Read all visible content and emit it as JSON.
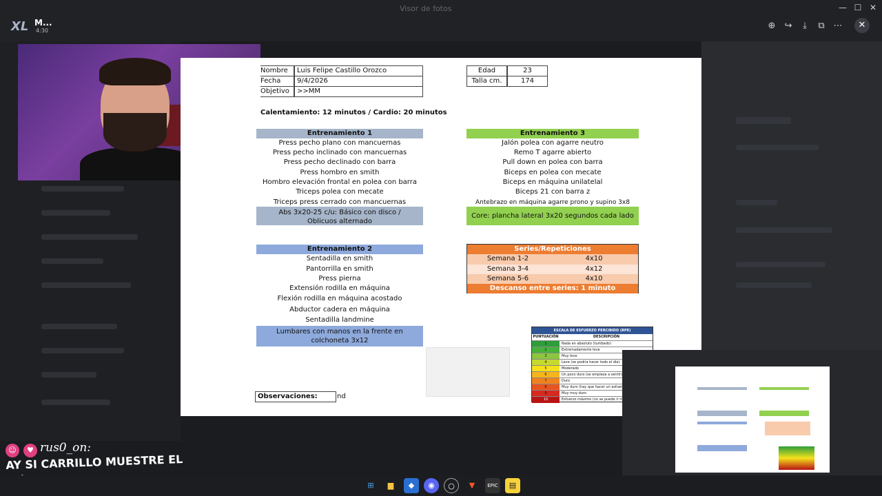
{
  "window": {
    "title": "Visor de fotos"
  },
  "chat_app": {
    "logo": "XL",
    "name": "M...",
    "time": "4:30"
  },
  "viewer_toolbar": {
    "icons": [
      "zoom-in-icon",
      "share-icon",
      "download-icon",
      "open-external-icon",
      "more-icon",
      "close-icon"
    ]
  },
  "sheet": {
    "info": [
      {
        "label": "Nombre",
        "value": "Luis Felipe Castillo Orozco"
      },
      {
        "label": "Fecha",
        "value": "9/4/2026"
      },
      {
        "label": "Objetivo",
        "value": ">>MM"
      }
    ],
    "stats": [
      {
        "label": "Edad",
        "value": "23"
      },
      {
        "label": "Talla cm.",
        "value": "174"
      }
    ],
    "warmup": "Calentamiento: 12 minutos / Cardio: 20 minutos",
    "training1": {
      "title": "Entrenamiento 1",
      "exercises": [
        "Press pecho plano con mancuernas",
        "Press pecho inclinado con mancuernas",
        "Press pecho declinado con barra",
        "Press hombro en smith",
        "Hombro elevación frontal en polea con barra",
        "Triceps polea con mecate",
        "Triceps press cerrado con mancuernas"
      ],
      "core": "Abs 3x20-25 c/u: Básico con disco / Oblicuos alternado"
    },
    "training2": {
      "title": "Entrenamiento 2",
      "exercises": [
        "Sentadilla en smith",
        "Pantorrilla en smith",
        "Press pierna",
        "Extensión rodilla en máquina",
        "Flexión rodilla en máquina acostado",
        "Abductor cadera en máquina",
        "Sentadilla landmine"
      ],
      "core": "Lumbares con manos en la frente en colchoneta 3x12"
    },
    "training3": {
      "title": "Entrenamiento 3",
      "exercises": [
        "Jalón polea con agarre neutro",
        "Remo T agarre abierto",
        "Pull down en polea con barra",
        "Biceps en polea con mecate",
        "Biceps en máquina unilatelal",
        "Biceps 21 con barra z",
        "Antebrazo en máquina agarre prono y supino 3x8"
      ],
      "core": "Core: plancha lateral 3x20 segundos cada lado"
    },
    "series": {
      "title": "Series/Repeticiones",
      "rows": [
        {
          "week": "Semana 1-2",
          "reps": "4x10"
        },
        {
          "week": "Semana 3-4",
          "reps": "4x12"
        },
        {
          "week": "Semana 5-6",
          "reps": "4x10"
        }
      ],
      "rest": "Descanso entre series: 1 minuto"
    },
    "rpe": {
      "title": "ESCALA DE ESFUERZO PERCIBIDO (RPE)",
      "col1": "PUNTUACIÓN",
      "col2": "DESCRIPCIÓN",
      "rows": [
        {
          "score": "1",
          "desc": "Nada en absoluto (tumbado)",
          "color": "#2e9e3a"
        },
        {
          "score": "2",
          "desc": "Extremadamente leve",
          "color": "#47b13c"
        },
        {
          "score": "3",
          "desc": "Muy leve",
          "color": "#8cc63f"
        },
        {
          "score": "4",
          "desc": "Leve (se podría hacer todo el día)",
          "color": "#c6d92f"
        },
        {
          "score": "5",
          "desc": "Moderado",
          "color": "#f5e11a"
        },
        {
          "score": "6",
          "desc": "Un poco duro (se empieza a sentir)",
          "color": "#f7b51b"
        },
        {
          "score": "7",
          "desc": "Duro",
          "color": "#f0821e"
        },
        {
          "score": "8",
          "desc": "Muy duro (hay que hacer un esfuerzo)",
          "color": "#e8541e"
        },
        {
          "score": "9",
          "desc": "Muy muy duro",
          "color": "#d8291e"
        },
        {
          "score": "10",
          "desc": "Esfuerzo máximo (no se puede ir más)",
          "color": "#b81414"
        }
      ]
    },
    "observations_label": "Observaciones:",
    "observations_value": "nd"
  },
  "chat": {
    "username": "rus0_on:",
    "message": "AY SI CARRILLO MUESTRE EL MÚSCULO"
  },
  "colors": {
    "header_gray": "#a6b5c9",
    "header_green": "#92d050",
    "header_blue": "#8ea9db",
    "header_orange": "#ed7d31",
    "row_light_orange": "#f8cbad",
    "row_lighter_orange": "#fce4d6"
  }
}
